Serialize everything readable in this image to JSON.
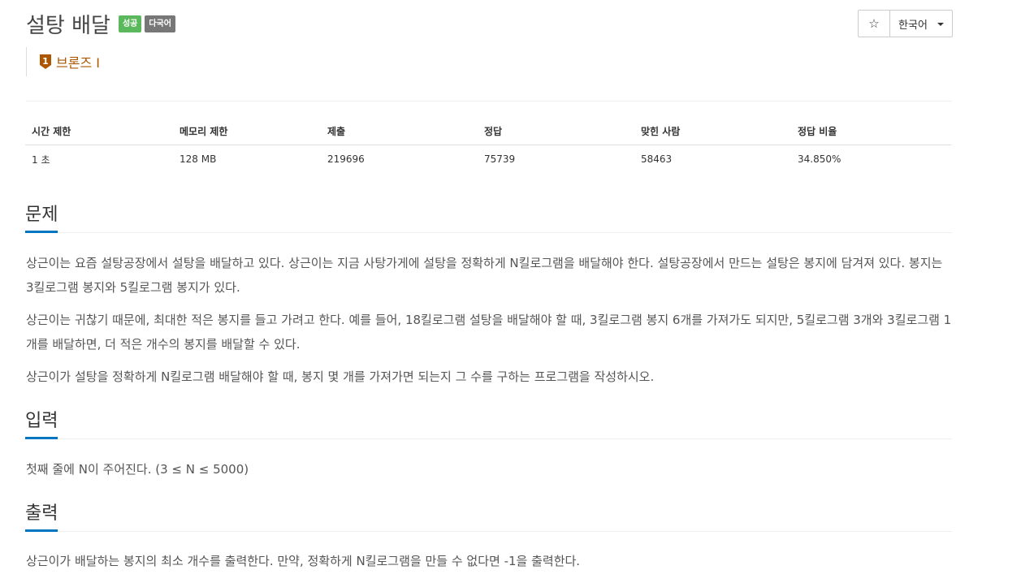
{
  "problem": {
    "title": "설탕 배달",
    "badges": [
      "성공",
      "다국어"
    ],
    "tier": "브론즈 I",
    "tier_number": "1",
    "tier_color": "#ad5600"
  },
  "toolbar": {
    "favorite_icon": "star-icon",
    "favorite_glyph": "☆",
    "language": "한국어"
  },
  "info_table": {
    "headers": [
      "시간 제한",
      "메모리 제한",
      "제출",
      "정답",
      "맞힌 사람",
      "정답 비율"
    ],
    "values": [
      "1 초",
      "128 MB",
      "219696",
      "75739",
      "58463",
      "34.850%"
    ]
  },
  "sections": {
    "description": {
      "title": "문제",
      "paragraphs": [
        "상근이는 요즘 설탕공장에서 설탕을 배달하고 있다. 상근이는 지금 사탕가게에 설탕을 정확하게 N킬로그램을 배달해야 한다. 설탕공장에서 만드는 설탕은 봉지에 담겨져 있다. 봉지는 3킬로그램 봉지와 5킬로그램 봉지가 있다.",
        "상근이는 귀찮기 때문에, 최대한 적은 봉지를 들고 가려고 한다. 예를 들어, 18킬로그램 설탕을 배달해야 할 때, 3킬로그램 봉지 6개를 가져가도 되지만, 5킬로그램 3개와 3킬로그램 1개를 배달하면, 더 적은 개수의 봉지를 배달할 수 있다.",
        "상근이가 설탕을 정확하게 N킬로그램 배달해야 할 때, 봉지 몇 개를 가져가면 되는지 그 수를 구하는 프로그램을 작성하시오."
      ]
    },
    "input": {
      "title": "입력",
      "text": "첫째 줄에 N이 주어진다. (3 ≤ N ≤ 5000)"
    },
    "output": {
      "title": "출력",
      "text": "상근이가 배달하는 봉지의 최소 개수를 출력한다. 만약, 정확하게 N킬로그램을 만들 수 없다면 -1을 출력한다."
    }
  },
  "colors": {
    "accent": "#0076c0",
    "success": "#5cb85c",
    "badge_gray": "#777777",
    "bronze": "#ad5600"
  }
}
